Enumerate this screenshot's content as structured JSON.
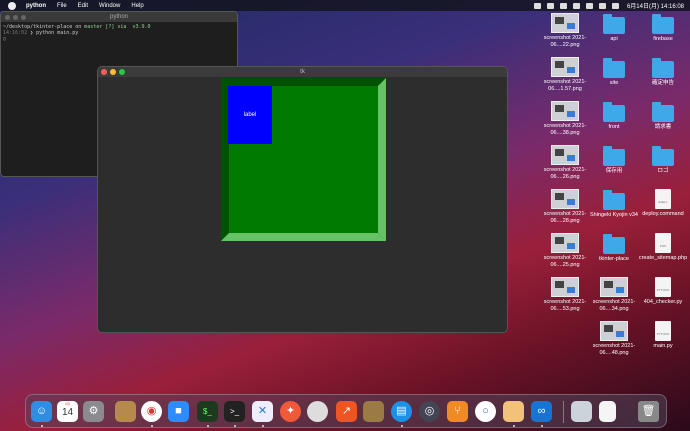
{
  "menubar": {
    "app": "python",
    "items": [
      "File",
      "Edit",
      "Window",
      "Help"
    ],
    "clock": "6月14日(月)  14:16:08"
  },
  "terminal": {
    "title": "python",
    "line1_path": "~/desktop/tkinter-place on",
    "line1_rest": " master [?] via  v3.9.0",
    "line2_time": "14:16:02",
    "line2_cmd": "❯ python main.py"
  },
  "tk_window": {
    "title": "tk",
    "label_text": "label"
  },
  "desktop": {
    "items": [
      {
        "name": "screenshot 2021-06....22.png",
        "kind": "thumb"
      },
      {
        "name": "api",
        "kind": "folder"
      },
      {
        "name": "firebase",
        "kind": "folder"
      },
      {
        "name": "screenshot 2021-06....1.57.png",
        "kind": "thumb"
      },
      {
        "name": "site",
        "kind": "folder"
      },
      {
        "name": "確定申告",
        "kind": "folder"
      },
      {
        "name": "screenshot 2021-06....38.png",
        "kind": "thumb"
      },
      {
        "name": "front",
        "kind": "folder"
      },
      {
        "name": "請求書",
        "kind": "folder"
      },
      {
        "name": "screenshot 2021-06....26.png",
        "kind": "thumb"
      },
      {
        "name": "保存用",
        "kind": "folder"
      },
      {
        "name": "ロゴ",
        "kind": "folder"
      },
      {
        "name": "screenshot 2021-06....28.png",
        "kind": "thumb"
      },
      {
        "name": "Shingeki Kyojin v34",
        "kind": "folder"
      },
      {
        "name": "deploy.command",
        "kind": "doc",
        "tag": "SHELL"
      },
      {
        "name": "screenshot 2021-06....25.png",
        "kind": "thumb"
      },
      {
        "name": "tkinter-place",
        "kind": "folder"
      },
      {
        "name": "create_sitemap.php",
        "kind": "doc",
        "tag": "PHP"
      },
      {
        "name": "screenshot 2021-06....53.png",
        "kind": "thumb"
      },
      {
        "name": "screenshot 2021-06....34.png",
        "kind": "thumb"
      },
      {
        "name": "404_checker.py",
        "kind": "doc",
        "tag": "PYTHON"
      },
      {
        "name": "screenshot 2021-06....48.png",
        "kind": "thumb"
      },
      {
        "name": "main.py",
        "kind": "doc",
        "tag": "PYTHON"
      }
    ]
  },
  "dock": {
    "calendar_month": "6月",
    "calendar_day": "14",
    "apps": [
      "finder-icon",
      "calendar-icon",
      "system-preferences-icon",
      "archive-utility-icon",
      "chrome-icon",
      "zoom-icon",
      "terminal-icon",
      "iterm-icon",
      "vscode-icon",
      "safari-icon",
      "sequel-pro-icon",
      "activity-icon",
      "keychain-icon",
      "docker-icon",
      "network-radar-icon",
      "sourcetree-icon",
      "postman-icon",
      "photo-booth-icon",
      "infinity-icon",
      "preview-icon",
      "document-icon",
      "trash-icon"
    ]
  }
}
